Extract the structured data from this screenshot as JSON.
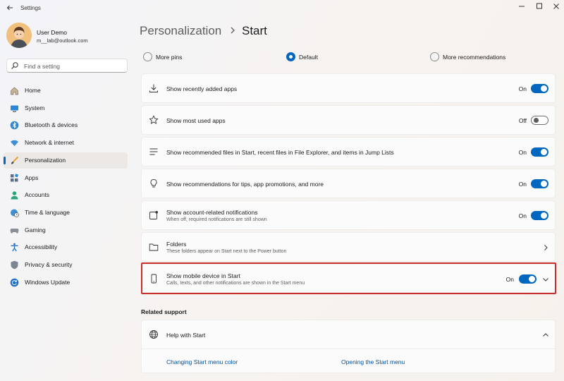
{
  "window": {
    "title": "Settings"
  },
  "user": {
    "name": "User Demo",
    "email": "m__lab@outlook.com"
  },
  "search": {
    "placeholder": "Find a setting"
  },
  "sidebar": {
    "items": [
      {
        "label": "Home",
        "icon": "home-icon"
      },
      {
        "label": "System",
        "icon": "system-icon"
      },
      {
        "label": "Bluetooth & devices",
        "icon": "bluetooth-icon"
      },
      {
        "label": "Network & internet",
        "icon": "wifi-icon"
      },
      {
        "label": "Personalization",
        "icon": "brush-icon",
        "active": true
      },
      {
        "label": "Apps",
        "icon": "apps-icon"
      },
      {
        "label": "Accounts",
        "icon": "accounts-icon"
      },
      {
        "label": "Time & language",
        "icon": "globe-clock-icon"
      },
      {
        "label": "Gaming",
        "icon": "gamepad-icon"
      },
      {
        "label": "Accessibility",
        "icon": "accessibility-icon"
      },
      {
        "label": "Privacy & security",
        "icon": "shield-icon"
      },
      {
        "label": "Windows Update",
        "icon": "update-icon"
      }
    ]
  },
  "breadcrumb": {
    "parent": "Personalization",
    "current": "Start"
  },
  "layout_options": {
    "selected": "Default",
    "options": [
      "More pins",
      "Default",
      "More recommendations"
    ]
  },
  "settings": [
    {
      "title": "Show recently added apps",
      "subtitle": "",
      "state": "On",
      "icon": "download-icon"
    },
    {
      "title": "Show most used apps",
      "subtitle": "",
      "state": "Off",
      "icon": "star-icon"
    },
    {
      "title": "Show recommended files in Start, recent files in File Explorer, and items in Jump Lists",
      "subtitle": "",
      "state": "On",
      "icon": "list-icon"
    },
    {
      "title": "Show recommendations for tips, app promotions, and more",
      "subtitle": "",
      "state": "On",
      "icon": "lightbulb-icon"
    },
    {
      "title": "Show account-related notifications",
      "subtitle": "When off, required notifications are still shown",
      "state": "On",
      "icon": "notification-icon"
    },
    {
      "title": "Folders",
      "subtitle": "These folders appear on Start next to the Power button",
      "state": "",
      "icon": "folder-icon"
    },
    {
      "title": "Show mobile device in Start",
      "subtitle": "Calls, texts, and other notifications are shown in the Start menu",
      "state": "On",
      "icon": "phone-icon"
    }
  ],
  "related_support": {
    "title": "Related support",
    "help": {
      "title": "Help with Start"
    },
    "links": [
      "Changing Start menu color",
      "Opening the Start menu"
    ]
  },
  "colors": {
    "accent": "#0067c0",
    "highlight": "#c9302c"
  }
}
